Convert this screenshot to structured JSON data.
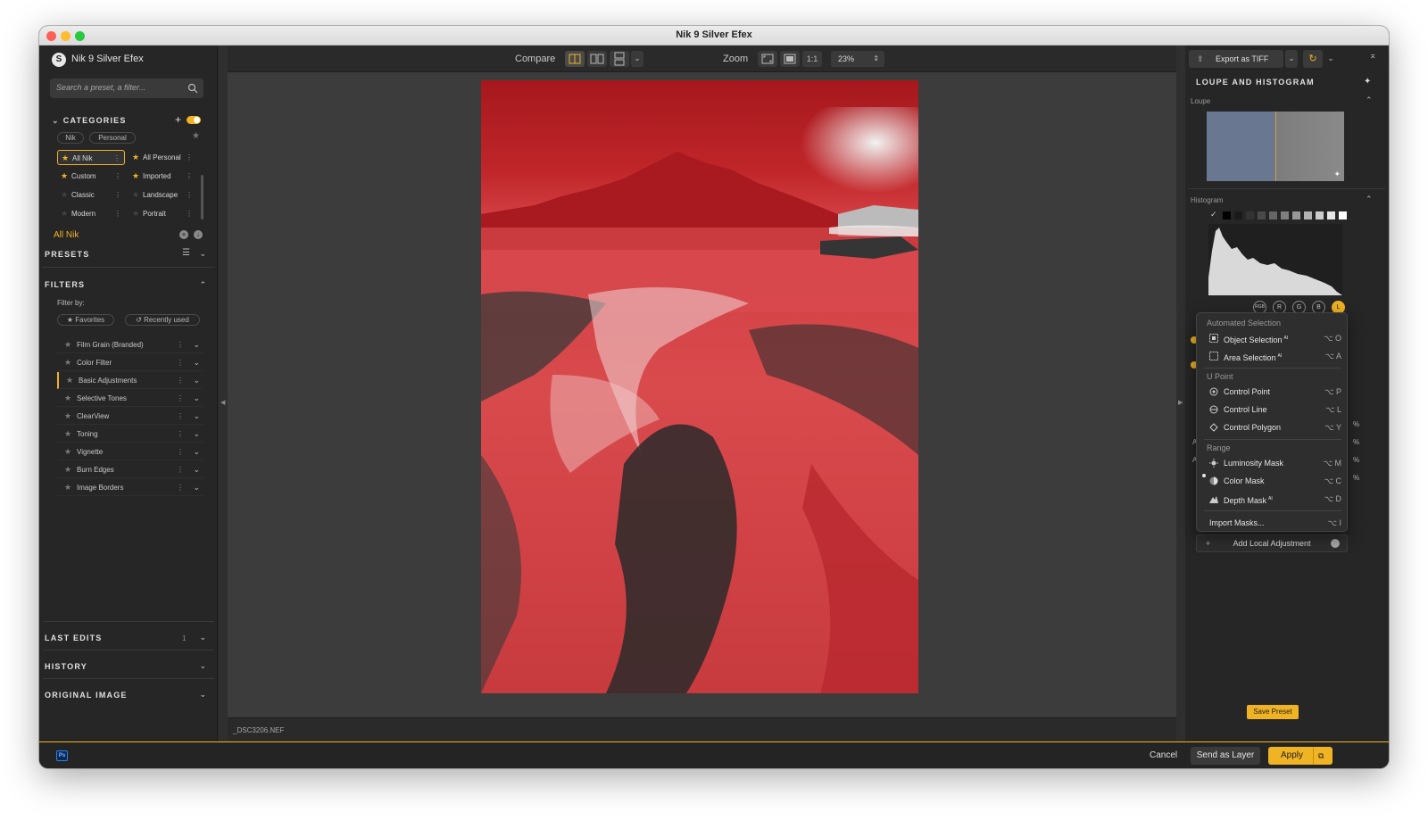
{
  "window": {
    "title": "Nik 9 Silver Efex"
  },
  "left": {
    "app_name": "Nik 9 Silver Efex",
    "search_placeholder": "Search a preset, a filter...",
    "categories_title": "CATEGORIES",
    "tabs": [
      "Nik",
      "Personal"
    ],
    "categories": [
      {
        "label": "All Nik",
        "selected": true
      },
      {
        "label": "All Personal"
      },
      {
        "label": "Custom"
      },
      {
        "label": "Imported"
      },
      {
        "label": "Classic"
      },
      {
        "label": "Landscape"
      },
      {
        "label": "Modern"
      },
      {
        "label": "Portrait"
      }
    ],
    "current_category": "All Nik",
    "presets_title": "PRESETS",
    "filters_title": "FILTERS",
    "filter_by": "Filter by:",
    "filter_chips": [
      "Favorites",
      "Recently used"
    ],
    "filters": [
      "Film Grain (Branded)",
      "Color Filter",
      "Basic Adjustments",
      "Selective Tones",
      "ClearView",
      "Toning",
      "Vignette",
      "Burn Edges",
      "Image Borders"
    ],
    "active_filter": "Basic Adjustments",
    "last_edits_title": "LAST EDITS",
    "last_edits_count": "1",
    "history_title": "HISTORY",
    "original_title": "ORIGINAL IMAGE"
  },
  "toolbar": {
    "compare_label": "Compare",
    "zoom_label": "Zoom",
    "one_to_one": "1:1",
    "zoom_value": "23%"
  },
  "canvas": {
    "filename": "_DSC3206.NEF"
  },
  "right": {
    "export_label": "Export as TIFF",
    "panel_title": "LOUPE AND HISTOGRAM",
    "loupe_label": "Loupe",
    "histogram_label": "Histogram",
    "channels": [
      "RGB",
      "R",
      "G",
      "B",
      "L"
    ],
    "active_channel": "L",
    "menu": {
      "automated_header": "Automated Selection",
      "object_selection": "Object Selection",
      "object_sc": "⌥ O",
      "area_selection": "Area Selection",
      "area_sc": "⌥ A",
      "ai_tag": "AI",
      "upoint_header": "U Point",
      "control_point": "Control Point",
      "control_point_sc": "⌥ P",
      "control_line": "Control Line",
      "control_line_sc": "⌥ L",
      "control_polygon": "Control Polygon",
      "control_polygon_sc": "⌥ Y",
      "range_header": "Range",
      "luminosity_mask": "Luminosity Mask",
      "luminosity_sc": "⌥ M",
      "color_mask": "Color Mask",
      "color_sc": "⌥ C",
      "depth_mask": "Depth Mask",
      "depth_sc": "⌥ D",
      "import_masks": "Import Masks...",
      "import_sc": "⌥ I"
    },
    "add_local": "Add Local Adjustment",
    "save_preset": "Save Preset"
  },
  "bottom": {
    "ps_badge": "Ps",
    "cancel": "Cancel",
    "send_layer": "Send as Layer",
    "apply": "Apply"
  },
  "colors": {
    "accent": "#f0b323",
    "panel": "#262626",
    "canvas": "#3c3c3c"
  }
}
